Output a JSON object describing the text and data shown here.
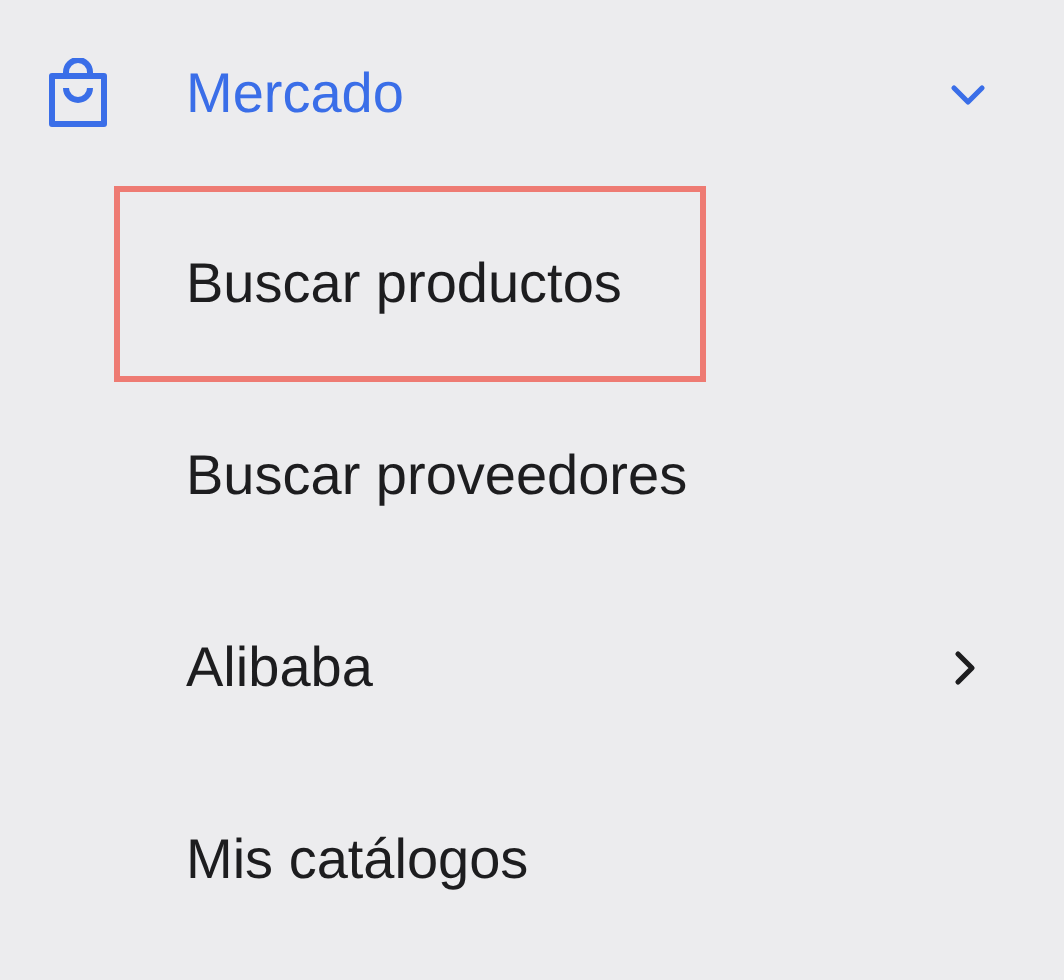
{
  "menu": {
    "title": "Mercado",
    "expanded": true,
    "items": [
      {
        "label": "Buscar productos",
        "highlighted": true,
        "has_submenu": false
      },
      {
        "label": "Buscar proveedores",
        "highlighted": false,
        "has_submenu": false
      },
      {
        "label": "Alibaba",
        "highlighted": false,
        "has_submenu": true
      },
      {
        "label": "Mis catálogos",
        "highlighted": false,
        "has_submenu": false
      }
    ]
  }
}
